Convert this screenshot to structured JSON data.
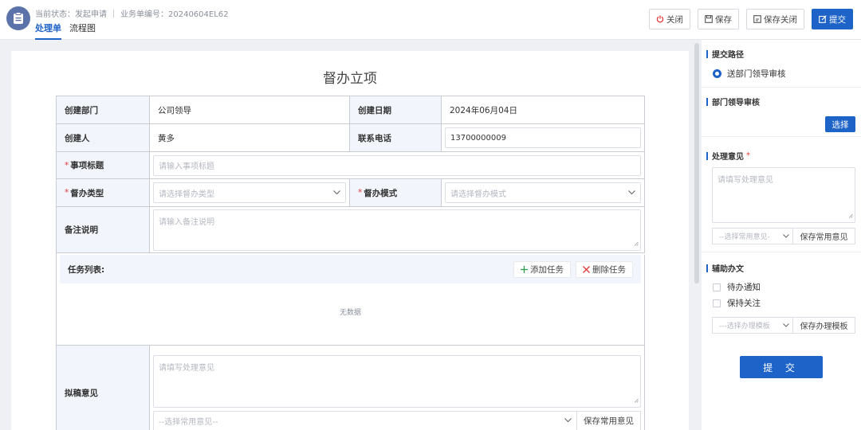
{
  "header": {
    "status_label": "当前状态：发起申请",
    "doc_number_label": "业务单编号：20240604EL62",
    "tabs": [
      {
        "label": "处理单",
        "active": true
      },
      {
        "label": "流程图",
        "active": false
      }
    ],
    "actions": {
      "close": "关闭",
      "save": "保存",
      "save_close": "保存关闭",
      "submit": "提交"
    }
  },
  "form": {
    "title": "督办立项",
    "rows": {
      "dept_label": "创建部门",
      "dept_value": "公司领导",
      "date_label": "创建日期",
      "date_value": "2024年06月04日",
      "creator_label": "创建人",
      "creator_value": "黄多",
      "phone_label": "联系电话",
      "phone_value": "13700000009",
      "subject_label": "事项标题",
      "subject_placeholder": "请输入事项标题",
      "type_label": "督办类型",
      "type_placeholder": "请选择督办类型",
      "mode_label": "督办模式",
      "mode_placeholder": "请选择督办模式",
      "remark_label": "备注说明",
      "remark_placeholder": "请输入备注说明"
    },
    "tasks": {
      "title": "任务列表:",
      "add_label": "添加任务",
      "delete_label": "删除任务",
      "empty_text": "无数据"
    },
    "draft": {
      "label": "拟稿意见",
      "placeholder": "请填写处理意见",
      "common_placeholder": "--选择常用意见--",
      "save_common": "保存常用意见"
    }
  },
  "panel": {
    "route": {
      "title": "提交路径",
      "option": "送部门领导审核"
    },
    "leader": {
      "title": "部门领导审核",
      "choose": "选择"
    },
    "opinion": {
      "title": "处理意见",
      "required_mark": "*",
      "placeholder": "请填写处理意见",
      "common_placeholder": "--选择常用意见-",
      "save_common": "保存常用意见"
    },
    "assist": {
      "title": "辅助办文",
      "options": [
        "待办通知",
        "保持关注"
      ],
      "template_placeholder": "---选择办理模板",
      "save_template": "保存办理模板"
    },
    "submit": "提 交"
  },
  "colors": {
    "primary": "#1e63c8",
    "required": "#e23b3b",
    "label_bg": "#f2f5fb"
  }
}
